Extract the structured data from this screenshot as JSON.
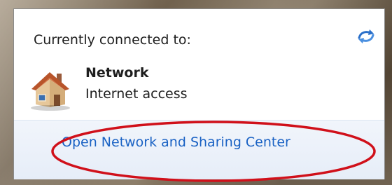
{
  "popup": {
    "header": "Currently connected to:",
    "network_name": "Network",
    "network_status": "Internet access",
    "link_label": "Open Network and Sharing Center"
  },
  "icons": {
    "refresh": "refresh-arrows-icon",
    "network": "house-icon"
  },
  "colors": {
    "link": "#1a62c4",
    "annotation": "#d0101a",
    "footer_bg": "#eaf0f9"
  }
}
